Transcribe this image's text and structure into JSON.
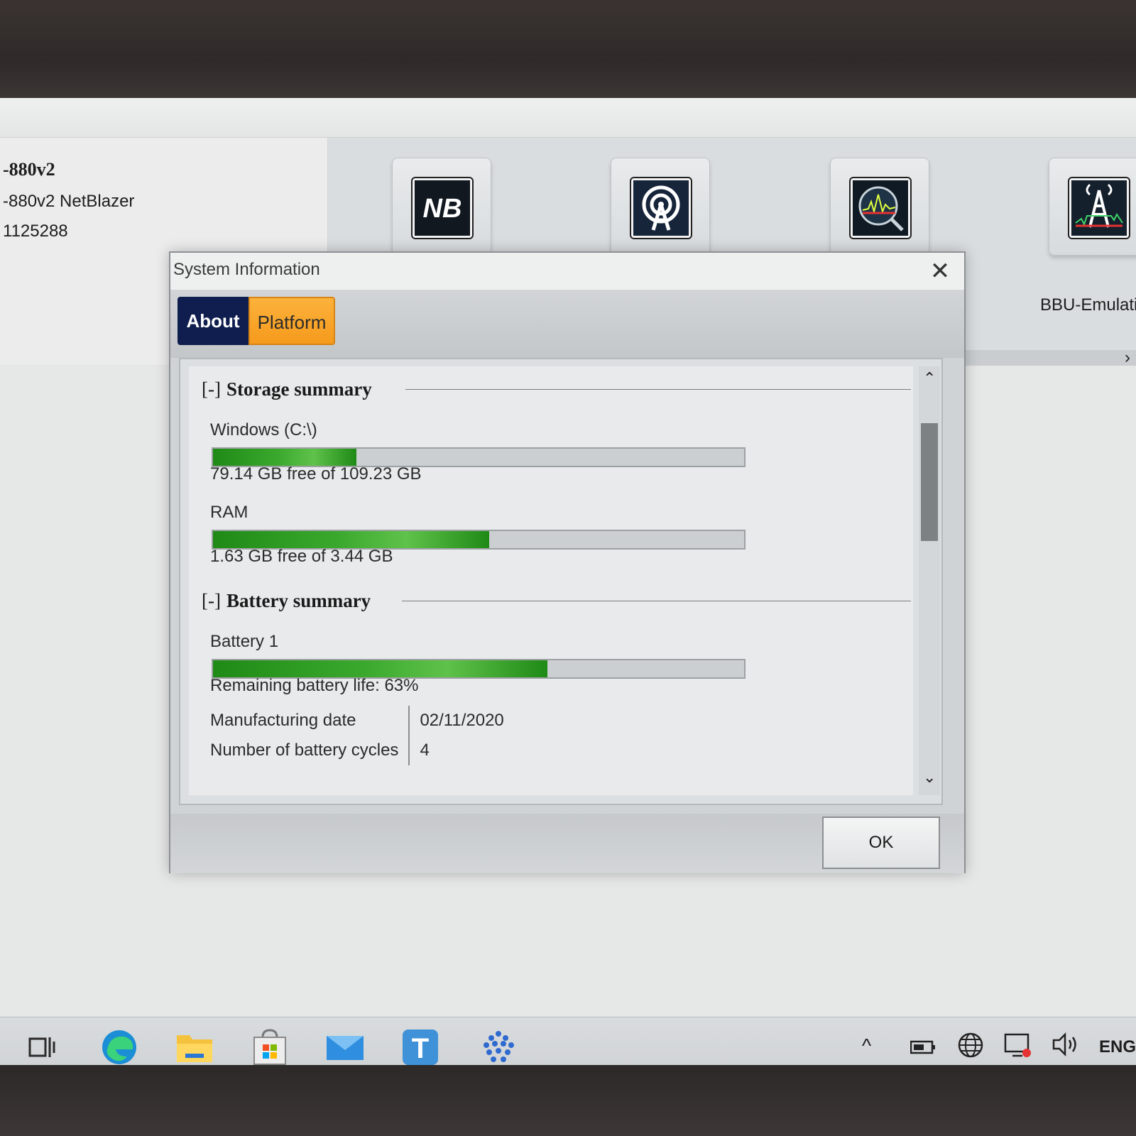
{
  "device": {
    "model": "-880v2",
    "name": "-880v2 NetBlazer",
    "serial": "1125288"
  },
  "apps": {
    "tiles": [
      {
        "icon": "netblazer-nb-icon",
        "text": "NB"
      },
      {
        "icon": "antenna-target-icon"
      },
      {
        "icon": "spectrum-analyzer-icon"
      },
      {
        "icon": "bbu-emulator-tower-icon"
      }
    ],
    "bbu_label": "BBU-Emulati",
    "scroll_right": "›"
  },
  "dialog": {
    "title": "System Information",
    "close_glyph": "✕",
    "tabs": [
      {
        "label": "About",
        "active": false
      },
      {
        "label": "Platform",
        "active": true
      }
    ],
    "storage": {
      "toggle": "[-]",
      "title": "Storage summary",
      "items": [
        {
          "label": "Windows (C:\\)",
          "summary": "79.14 GB free of 109.23 GB",
          "fill_fraction": 0.27
        },
        {
          "label": "RAM",
          "summary": "1.63 GB free of 3.44 GB",
          "fill_fraction": 0.52
        }
      ]
    },
    "battery": {
      "toggle": "[-]",
      "title": "Battery summary",
      "item": {
        "label": "Battery 1",
        "summary": "Remaining battery life: 63%",
        "fill_fraction": 0.63
      },
      "details": [
        {
          "key": "Manufacturing date",
          "value": "02/11/2020"
        },
        {
          "key": "Number of battery cycles",
          "value": "4"
        }
      ]
    },
    "scroll_up": "⌃",
    "scroll_down": "⌄",
    "ok_label": "OK"
  },
  "taskbar": {
    "items": [
      {
        "icon": "task-view-icon"
      },
      {
        "icon": "edge-icon"
      },
      {
        "icon": "file-explorer-icon"
      },
      {
        "icon": "store-icon"
      },
      {
        "icon": "mail-icon"
      },
      {
        "icon": "t-app-icon",
        "text": "T",
        "active": true
      },
      {
        "icon": "dots-app-icon",
        "active": true
      }
    ],
    "tray": {
      "chevron": "^",
      "language": "ENG"
    }
  },
  "colors": {
    "about_tab_bg": "#0f1e4e",
    "platform_tab_bg": "#f59a1c",
    "bar_fill": "#1f8a16",
    "accent": "#2b77d4"
  }
}
